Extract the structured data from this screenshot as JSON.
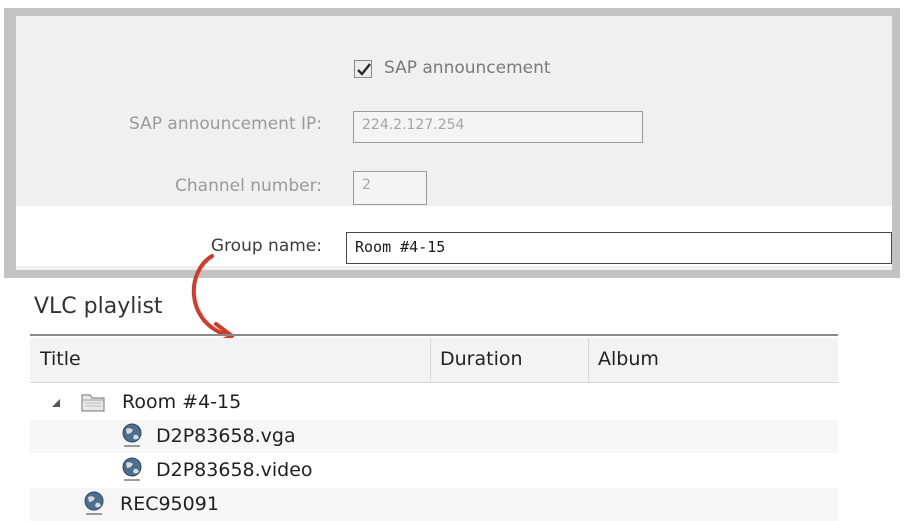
{
  "settings": {
    "sap_checkbox_label": "SAP announcement",
    "sap_checked": true,
    "sap_ip_label": "SAP announcement IP:",
    "sap_ip_value": "224.2.127.254",
    "channel_label": "Channel number:",
    "channel_value": "2",
    "group_label": "Group name:",
    "group_value": "Room #4-15"
  },
  "playlist": {
    "title": "VLC playlist",
    "columns": [
      "Title",
      "Duration",
      "Album"
    ],
    "items": [
      {
        "label": "Room #4-15",
        "type": "folder",
        "expanded": true
      },
      {
        "label": "D2P83658.vga",
        "type": "stream"
      },
      {
        "label": "D2P83658.video",
        "type": "stream"
      },
      {
        "label": "REC95091",
        "type": "stream"
      }
    ]
  },
  "colors": {
    "arrow": "#d23a2a",
    "frame": "#c3c3c3"
  }
}
